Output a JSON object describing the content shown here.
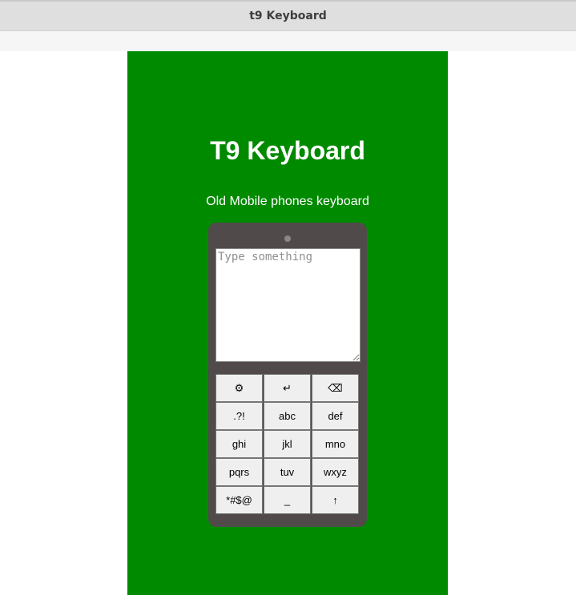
{
  "window": {
    "title": "t9 Keyboard"
  },
  "app": {
    "heading": "T9 Keyboard",
    "subheading": "Old Mobile phones keyboard"
  },
  "screen": {
    "placeholder": "Type something",
    "value": ""
  },
  "keypad": {
    "keys": [
      {
        "label": "⚙",
        "name": "settings-key"
      },
      {
        "label": "↵",
        "name": "enter-key"
      },
      {
        "label": "⌫",
        "name": "backspace-key"
      },
      {
        "label": ".?!",
        "name": "key-1-punctuation"
      },
      {
        "label": "abc",
        "name": "key-2-abc"
      },
      {
        "label": "def",
        "name": "key-3-def"
      },
      {
        "label": "ghi",
        "name": "key-4-ghi"
      },
      {
        "label": "jkl",
        "name": "key-5-jkl"
      },
      {
        "label": "mno",
        "name": "key-6-mno"
      },
      {
        "label": "pqrs",
        "name": "key-7-pqrs"
      },
      {
        "label": "tuv",
        "name": "key-8-tuv"
      },
      {
        "label": "wxyz",
        "name": "key-9-wxyz"
      },
      {
        "label": "*#$@",
        "name": "key-symbols"
      },
      {
        "label": "_",
        "name": "key-space"
      },
      {
        "label": "↑",
        "name": "shift-key"
      }
    ]
  },
  "colors": {
    "panel": "#008a00",
    "phone_body": "#504a4a",
    "key_bg": "#efefef"
  }
}
